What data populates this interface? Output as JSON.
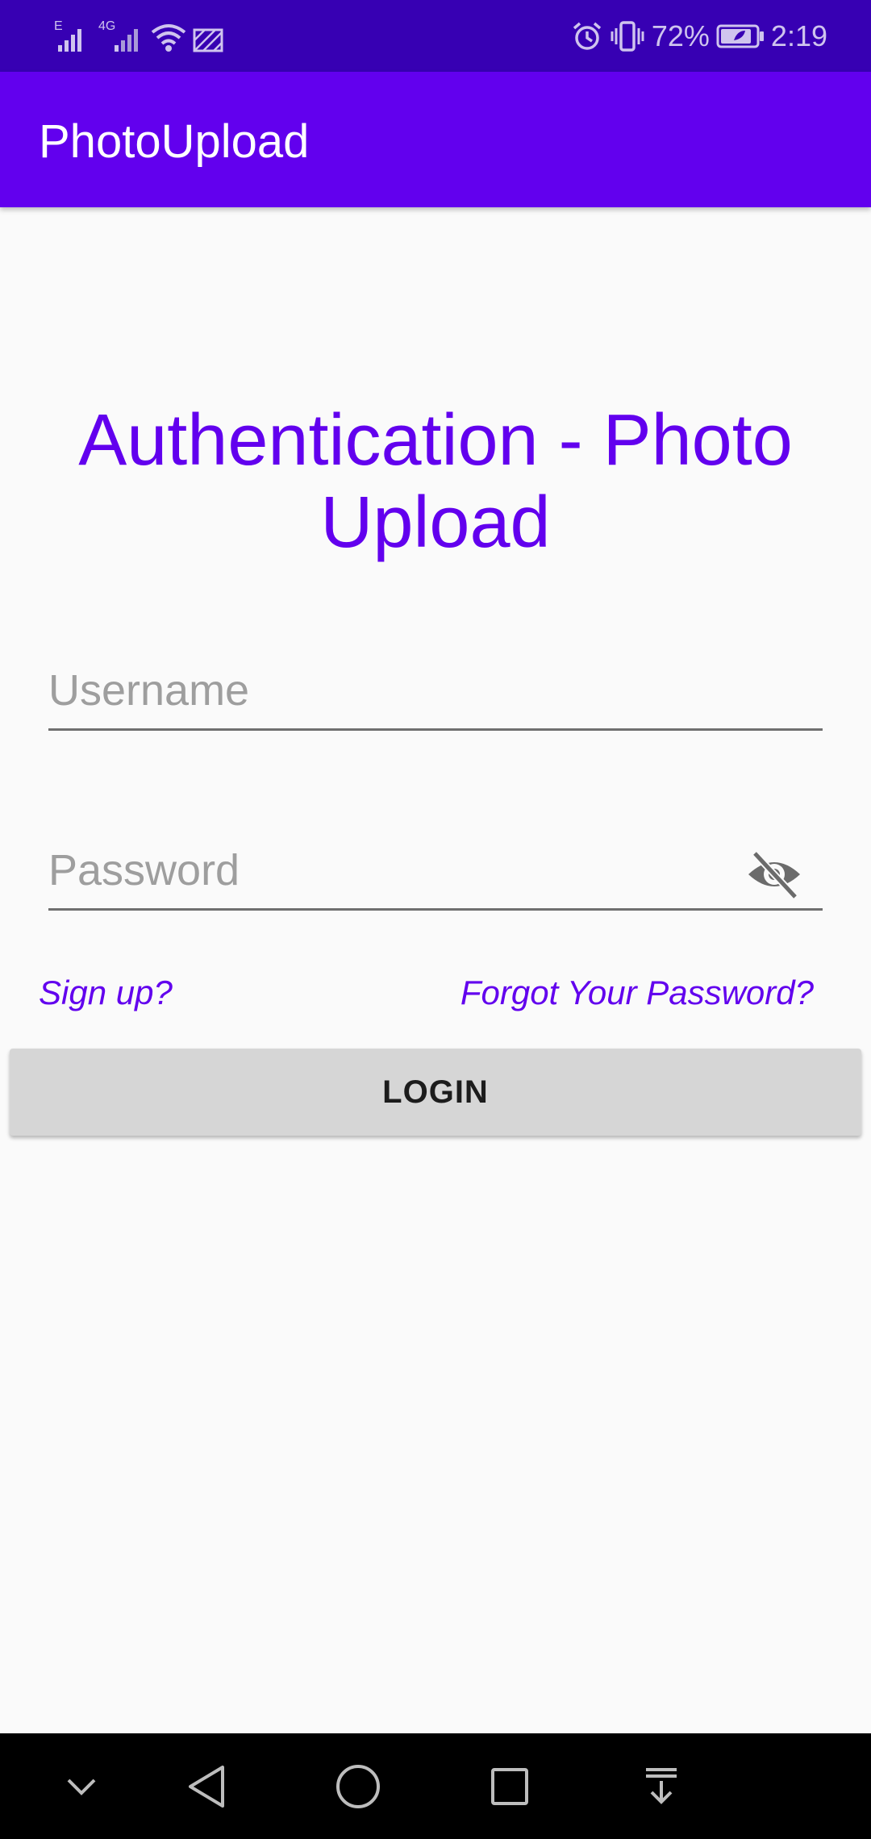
{
  "status_bar": {
    "battery_percent": "72%",
    "time": "2:19",
    "network_label": "4G",
    "signal_label": "E",
    "icons": [
      "signal-icon",
      "signal-4g-icon",
      "wifi-icon",
      "no-sim-icon",
      "alarm-icon",
      "vibrate-icon",
      "battery-icon"
    ]
  },
  "app_bar": {
    "title": "PhotoUpload"
  },
  "login_form": {
    "heading": "Authentication - Photo Upload",
    "username_placeholder": "Username",
    "password_placeholder": "Password",
    "password_toggle_icon": "eye-off-icon",
    "signup_link": "Sign up?",
    "forgot_link": "Forgot Your Password?",
    "login_button": "LOGIN"
  },
  "nav_bar": {
    "icons": [
      "chevron-down-icon",
      "back-icon",
      "home-icon",
      "recents-icon",
      "notification-pull-icon"
    ]
  },
  "colors": {
    "status_bar": "#3700b3",
    "primary": "#6200ee",
    "background": "#fafafa",
    "button": "#d6d6d6",
    "nav_bar": "#000000"
  }
}
